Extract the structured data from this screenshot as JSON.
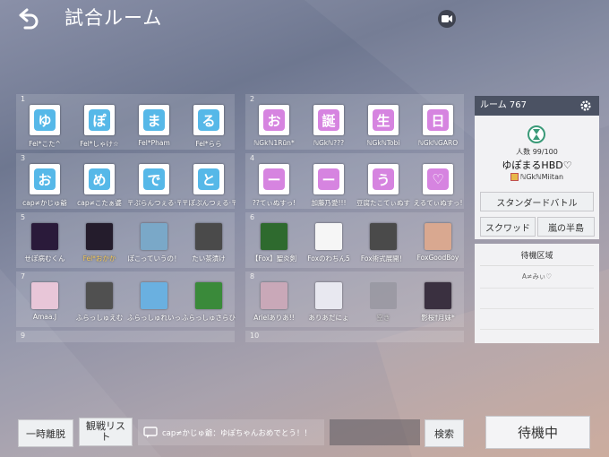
{
  "title": "試合ルーム",
  "room": {
    "name": "ルーム 767",
    "count": "人数 99/100",
    "subject": "ゆぽまるHBD♡",
    "host": "ℕGkℕMiitan",
    "mode": "スタンダードバトル",
    "squad": "スクワッド",
    "map": "嵐の半島"
  },
  "wait_area": {
    "title": "待機区域",
    "first": "A≠みぃ♡"
  },
  "teams": [
    {
      "num": "1",
      "players": [
        {
          "name": "Fel*こた^",
          "char": "ゆ",
          "color": "#56b8e8"
        },
        {
          "name": "Fel*しゃけ☆",
          "char": "ぽ",
          "color": "#56b8e8"
        },
        {
          "name": "Fel*Pham",
          "char": "ま",
          "color": "#56b8e8"
        },
        {
          "name": "Fel*らら",
          "char": "る",
          "color": "#56b8e8"
        }
      ]
    },
    {
      "num": "2",
      "players": [
        {
          "name": "ℕGkℕ1Rūn*",
          "char": "お",
          "color": "#d684e0"
        },
        {
          "name": "ℕGkℕ???",
          "char": "誕",
          "color": "#d684e0"
        },
        {
          "name": "ℕGkℕTobi",
          "char": "生",
          "color": "#d684e0"
        },
        {
          "name": "ℕGkℕGARO",
          "char": "日",
          "color": "#d684e0"
        }
      ]
    },
    {
      "num": "3",
      "players": [
        {
          "name": "cap≠かじゅ爺",
          "char": "お",
          "color": "#56b8e8"
        },
        {
          "name": "cap≠こたぁ婆",
          "char": "め",
          "color": "#56b8e8"
        },
        {
          "name": "〒ぷらんつぇる·〒",
          "char": "で",
          "color": "#56b8e8"
        },
        {
          "name": "〒ぽぷんつぇる·〒",
          "char": "と",
          "color": "#56b8e8"
        }
      ]
    },
    {
      "num": "4",
      "players": [
        {
          "name": "??てぃぬすっ!",
          "char": "ー",
          "color": "#d684e0"
        },
        {
          "name": "加藤乃愛!!!",
          "char": "ー",
          "color": "#d684e0"
        },
        {
          "name": "豆腐たこてぃぬすっ!",
          "char": "う",
          "color": "#d684e0"
        },
        {
          "name": "えるてぃぬすっ!",
          "char": "♡",
          "color": "#d684e0"
        }
      ]
    },
    {
      "num": "5",
      "players": [
        {
          "name": "せぽ病むくん",
          "bg": "#2a1a3a"
        },
        {
          "name": "Fel*おかか",
          "bg": "#241c2c",
          "gold": true
        },
        {
          "name": "ぽこっていうの！",
          "bg": "#7aa8c8"
        },
        {
          "name": "たい茶漬け",
          "bg": "#4a4a4a"
        }
      ]
    },
    {
      "num": "6",
      "players": [
        {
          "name": "【Fox】聖炎剣",
          "bg": "#2e6a2e"
        },
        {
          "name": "Foxのわちん5",
          "bg": "#f6f6f6"
        },
        {
          "name": "Fox術式展開！",
          "bg": "#4a4a4a"
        },
        {
          "name": "FoxGoodBoy",
          "bg": "#d9a890"
        }
      ]
    },
    {
      "num": "7",
      "players": [
        {
          "name": "Amaa.J",
          "bg": "#e8c6d8"
        },
        {
          "name": "ふらっしゅえむ",
          "bg": "#505050"
        },
        {
          "name": "ふらっしゅれいっ",
          "bg": "#6ab0e0"
        },
        {
          "name": "ふらっしゅさらひめ",
          "bg": "#3a8a3a"
        }
      ]
    },
    {
      "num": "8",
      "players": [
        {
          "name": "Arielありあ!!",
          "bg": "#c9a8b8"
        },
        {
          "name": "ありあだにょ",
          "bg": "#e8e8f0"
        },
        {
          "name": "空き",
          "empty": true
        },
        {
          "name": "影桜†月妹*",
          "bg": "#3a3040"
        }
      ]
    },
    {
      "num": "9",
      "players": []
    },
    {
      "num": "10",
      "players": []
    }
  ],
  "bottom": {
    "leave": "一時離脱",
    "spectate": "観戦リスト",
    "chat": "cap≠かじゅ爺：ゆぽちゃんおめでとう！！",
    "search": "検索",
    "ready": "待機中"
  }
}
